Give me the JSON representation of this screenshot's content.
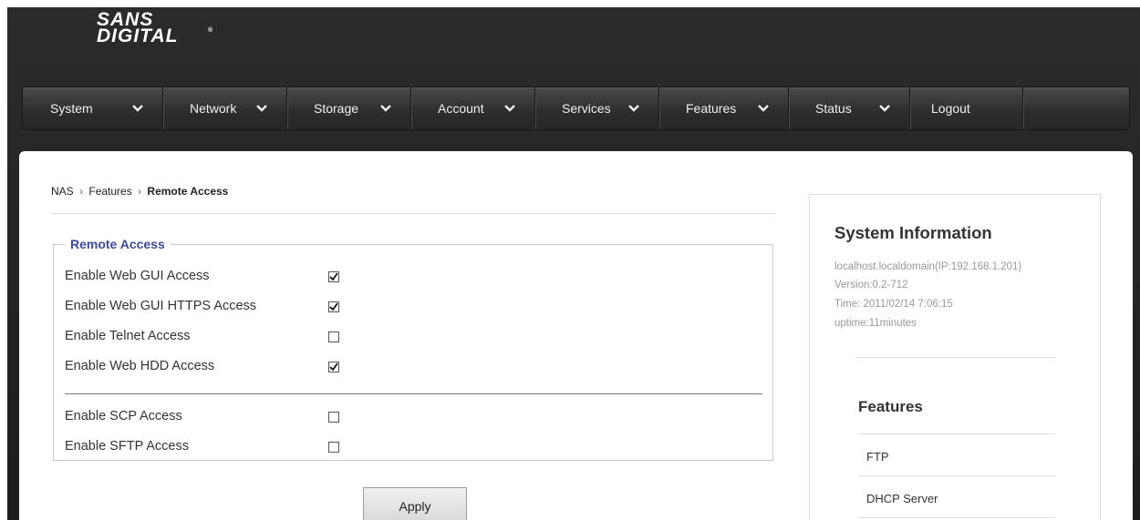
{
  "logo": {
    "line1": "SANS",
    "line2": "DIGITAL",
    "tm": "®"
  },
  "nav": {
    "items": [
      {
        "label": "System",
        "has_dropdown": true
      },
      {
        "label": "Network",
        "has_dropdown": true
      },
      {
        "label": "Storage",
        "has_dropdown": true
      },
      {
        "label": "Account",
        "has_dropdown": true
      },
      {
        "label": "Services",
        "has_dropdown": true
      },
      {
        "label": "Features",
        "has_dropdown": true
      },
      {
        "label": "Status",
        "has_dropdown": true
      },
      {
        "label": "Logout",
        "has_dropdown": false
      }
    ]
  },
  "breadcrumb": {
    "root": "NAS",
    "parent": "Features",
    "current": "Remote Access",
    "separator": "›"
  },
  "remote_access": {
    "legend": "Remote Access",
    "options": [
      {
        "label": "Enable Web GUI Access",
        "checked": true
      },
      {
        "label": "Enable Web GUI HTTPS Access",
        "checked": true
      },
      {
        "label": "Enable Telnet Access",
        "checked": false
      },
      {
        "label": "Enable Web HDD Access",
        "checked": true
      },
      {
        "label": "Enable SCP Access",
        "checked": false
      },
      {
        "label": "Enable SFTP Access",
        "checked": false
      }
    ],
    "apply_label": "Apply"
  },
  "system_info": {
    "title": "System Information",
    "host": "localhost.localdomain(IP:192.168.1.201)",
    "version": "Version:0.2-712",
    "time": "Time: 2011/02/14 7:06:15",
    "uptime": "uptime:11minutes"
  },
  "features": {
    "title": "Features",
    "items": [
      "FTP",
      "DHCP Server"
    ]
  },
  "colors": {
    "accent": "#3d4b9a",
    "nav_bg": "#2e2e2e",
    "page_bg": "#1d1d1d"
  }
}
